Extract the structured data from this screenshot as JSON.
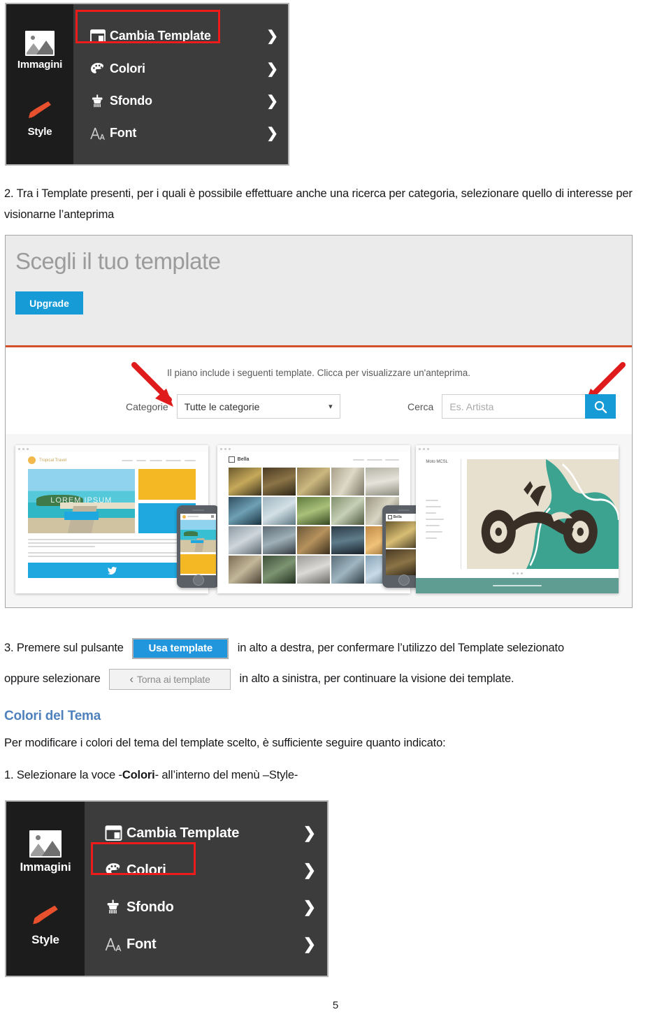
{
  "document": {
    "page_number": "5",
    "paragraph_2": "2. Tra i Template presenti, per i quali è possibile effettuare anche una ricerca per categoria, selezionare quello di interesse per visionarne l’anteprima",
    "paragraph_3_part1": "3. Premere sul pulsante",
    "paragraph_3_part2": "in alto a destra, per confermare l’utilizzo del Template selezionato",
    "paragraph_3_part3": "oppure selezionare",
    "paragraph_3_part4": "in alto a sinistra, per continuare la visione dei template.",
    "section_heading": "Colori del Tema",
    "section_intro": "Per modificare i colori del tema del template scelto, è sufficiente seguire quanto indicato:",
    "step_1_pre": "1. Selezionare la voce -",
    "step_1_bold": "Colori",
    "step_1_post": "- all’interno del menù –Style-"
  },
  "inline_buttons": {
    "use_template": "Usa template",
    "back_to_templates": "Torna ai template",
    "back_chevron": "‹"
  },
  "style_menu_top": {
    "rail": [
      {
        "label": "Immagini",
        "icon": "image-icon"
      },
      {
        "label": "Style",
        "icon": "brush-icon"
      }
    ],
    "items": [
      {
        "label": "Cambia Template",
        "icon": "layout-icon",
        "chevron": "❯",
        "highlighted": true
      },
      {
        "label": "Colori",
        "icon": "palette-icon",
        "chevron": "❯",
        "highlighted": false
      },
      {
        "label": "Sfondo",
        "icon": "paint-roller-icon",
        "chevron": "❯",
        "highlighted": false
      },
      {
        "label": "Font",
        "icon": "font-icon",
        "chevron": "❯",
        "highlighted": false
      }
    ],
    "highlight_color": "#ee1b1b",
    "panel_color": "#3c3c3c",
    "rail_color": "#1c1c1c"
  },
  "style_menu_bottom": {
    "rail": [
      {
        "label": "Immagini",
        "icon": "image-icon"
      },
      {
        "label": "Style",
        "icon": "brush-icon"
      }
    ],
    "items": [
      {
        "label": "Cambia Template",
        "icon": "layout-icon",
        "chevron": "❯",
        "highlighted": false
      },
      {
        "label": "Colori",
        "icon": "palette-icon",
        "chevron": "❯",
        "highlighted": true
      },
      {
        "label": "Sfondo",
        "icon": "paint-roller-icon",
        "chevron": "❯",
        "highlighted": false
      },
      {
        "label": "Font",
        "icon": "font-icon",
        "chevron": "❯",
        "highlighted": false
      }
    ],
    "highlight_color": "#ee1b1b"
  },
  "template_chooser": {
    "title": "Scegli il tuo template",
    "upgrade_button": "Upgrade",
    "subtitle": "Il piano include i seguenti template. Clicca per visualizzare un'anteprima.",
    "category_label": "Categorie",
    "category_value": "Tutte le categorie",
    "category_caret": "▾",
    "search_label": "Cerca",
    "search_placeholder": "Es. Artista",
    "search_icon": "magnifier-icon",
    "accent_blue": "#169bd7",
    "accent_orange": "#d4502a",
    "templates": [
      {
        "name": "Tropical Travel",
        "hero_text": "LOREM IPSUM",
        "style": "travel"
      },
      {
        "name": "Bella",
        "hero_text": "",
        "style": "photo-grid"
      },
      {
        "name": "Moto MCSL",
        "hero_text": "",
        "style": "illustration"
      }
    ]
  }
}
